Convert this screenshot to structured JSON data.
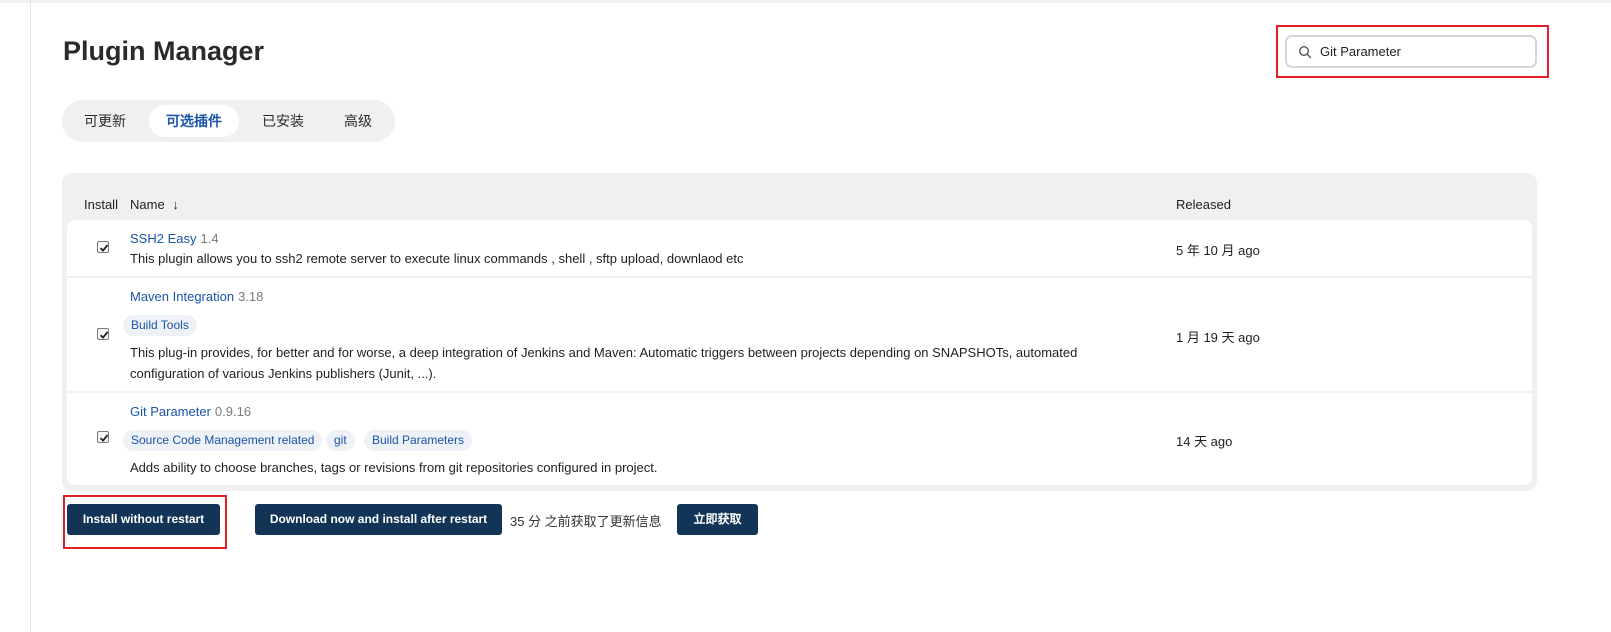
{
  "page": {
    "title": "Plugin Manager"
  },
  "search": {
    "value": "Git Parameter",
    "placeholder": ""
  },
  "tabs": [
    {
      "label": "可更新",
      "active": false
    },
    {
      "label": "可选插件",
      "active": true
    },
    {
      "label": "已安装",
      "active": false
    },
    {
      "label": "高级",
      "active": false
    }
  ],
  "table": {
    "headers": {
      "install": "Install",
      "name": "Name",
      "sort_indicator": "↓",
      "released": "Released"
    },
    "rows": [
      {
        "checked": true,
        "name": "SSH2 Easy",
        "version": "1.4",
        "tags": [],
        "description": "This plugin allows you to ssh2 remote server to execute linux commands , shell , sftp upload, downlaod etc",
        "released": "5 年 10 月 ago"
      },
      {
        "checked": true,
        "name": "Maven Integration",
        "version": "3.18",
        "tags": [
          "Build Tools"
        ],
        "description_line1": "This plug-in provides, for better and for worse, a deep integration of Jenkins and Maven: Automatic triggers between projects depending on SNAPSHOTs, automated",
        "description_line2": "configuration of various Jenkins publishers (Junit, ...).",
        "released": "1 月 19 天 ago"
      },
      {
        "checked": true,
        "name": "Git Parameter",
        "version": "0.9.16",
        "tags": [
          "Source Code Management related",
          "git",
          "Build Parameters"
        ],
        "description": "Adds ability to choose branches, tags or revisions from git repositories configured in project.",
        "released": "14 天 ago"
      }
    ]
  },
  "actions": {
    "install_without_restart": "Install without restart",
    "download_and_install": "Download now and install after restart",
    "update_status": "35 分 之前获取了更新信息",
    "fetch_now": "立即获取"
  },
  "colors": {
    "accent_link": "#1a55a8",
    "button_bg": "#123457",
    "highlight_red": "#e41e26"
  }
}
